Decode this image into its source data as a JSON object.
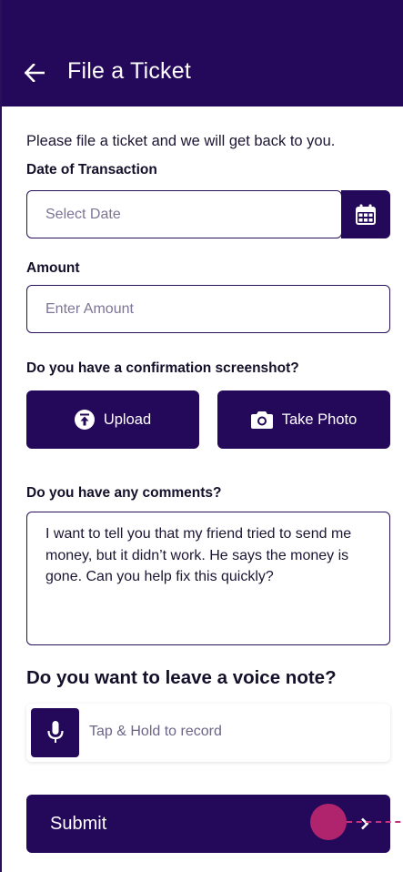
{
  "header": {
    "title": "File a Ticket",
    "back_icon": "arrow-left-icon"
  },
  "intro_text": "Please file a ticket and we will get back to you.",
  "date": {
    "label": "Date of Transaction",
    "placeholder": "Select Date",
    "icon": "calendar-icon"
  },
  "amount": {
    "label": "Amount",
    "placeholder": "Enter Amount"
  },
  "screenshot": {
    "label": "Do you have a confirmation screenshot?",
    "upload_label": "Upload",
    "upload_icon": "upload-icon",
    "photo_label": "Take Photo",
    "photo_icon": "camera-icon"
  },
  "comments": {
    "label": "Do you have any comments?",
    "value": "I want to tell you that my friend tried to send me money, but it didn’t work. He says the money is gone. Can you help fix this quickly?"
  },
  "voice": {
    "heading": "Do you want to leave a voice note?",
    "hint": "Tap & Hold to record",
    "icon": "microphone-icon"
  },
  "submit": {
    "label": "Submit",
    "icon": "chevron-right-icon"
  },
  "colors": {
    "primary": "#24085a",
    "touch_indicator": "#b0246e"
  }
}
